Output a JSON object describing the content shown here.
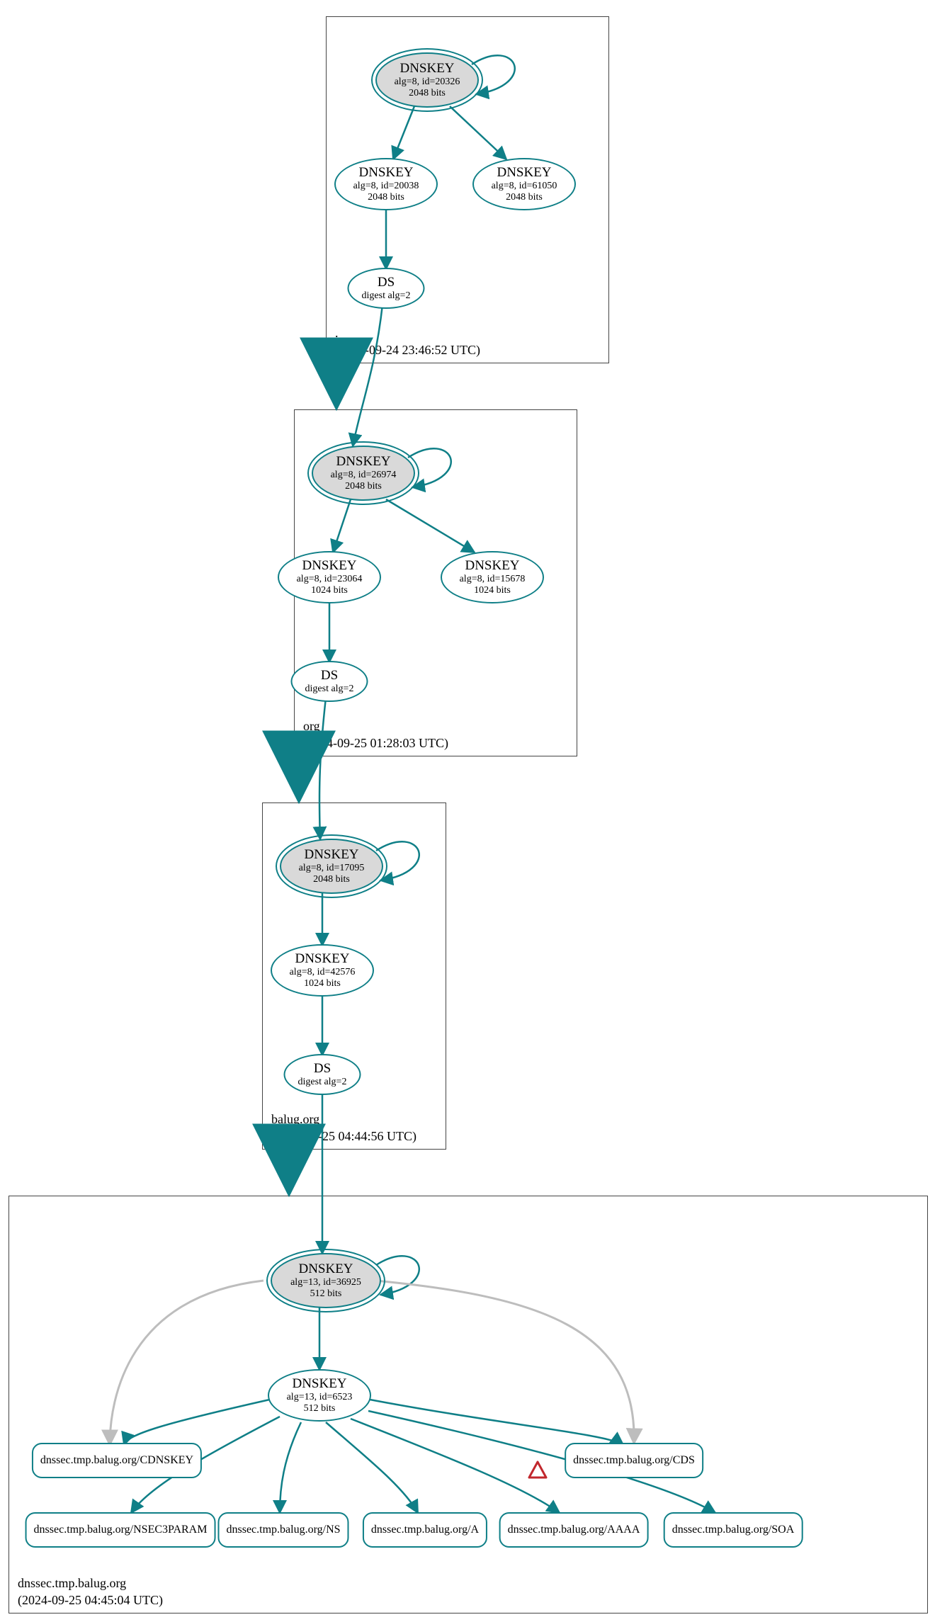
{
  "colors": {
    "edge": "#0F7F87",
    "gray": "#bdbdbd",
    "warn": "#C1272D"
  },
  "zones": {
    "root": {
      "label": ".",
      "timestamp": "(2024-09-24 23:46:52 UTC)"
    },
    "org": {
      "label": "org",
      "timestamp": "(2024-09-25 01:28:03 UTC)"
    },
    "balug": {
      "label": "balug.org",
      "timestamp": "(2024-09-25 04:44:56 UTC)"
    },
    "dnssec": {
      "label": "dnssec.tmp.balug.org",
      "timestamp": "(2024-09-25 04:45:04 UTC)"
    }
  },
  "nodes": {
    "root_ksk": {
      "title": "DNSKEY",
      "line2": "alg=8, id=20326",
      "line3": "2048 bits"
    },
    "root_zsk1": {
      "title": "DNSKEY",
      "line2": "alg=8, id=20038",
      "line3": "2048 bits"
    },
    "root_zsk2": {
      "title": "DNSKEY",
      "line2": "alg=8, id=61050",
      "line3": "2048 bits"
    },
    "root_ds": {
      "title": "DS",
      "line2": "digest alg=2"
    },
    "org_ksk": {
      "title": "DNSKEY",
      "line2": "alg=8, id=26974",
      "line3": "2048 bits"
    },
    "org_zsk1": {
      "title": "DNSKEY",
      "line2": "alg=8, id=23064",
      "line3": "1024 bits"
    },
    "org_zsk2": {
      "title": "DNSKEY",
      "line2": "alg=8, id=15678",
      "line3": "1024 bits"
    },
    "org_ds": {
      "title": "DS",
      "line2": "digest alg=2"
    },
    "balug_ksk": {
      "title": "DNSKEY",
      "line2": "alg=8, id=17095",
      "line3": "2048 bits"
    },
    "balug_zsk": {
      "title": "DNSKEY",
      "line2": "alg=8, id=42576",
      "line3": "1024 bits"
    },
    "balug_ds": {
      "title": "DS",
      "line2": "digest alg=2"
    },
    "dnssec_ksk": {
      "title": "DNSKEY",
      "line2": "alg=13, id=36925",
      "line3": "512 bits"
    },
    "dnssec_zsk": {
      "title": "DNSKEY",
      "line2": "alg=13, id=6523",
      "line3": "512 bits"
    }
  },
  "records": {
    "cds": {
      "label": "dnssec.tmp.balug.org/CDS"
    },
    "cdnskey": {
      "label": "dnssec.tmp.balug.org/CDNSKEY"
    },
    "nsec3param": {
      "label": "dnssec.tmp.balug.org/NSEC3PARAM"
    },
    "ns": {
      "label": "dnssec.tmp.balug.org/NS"
    },
    "a": {
      "label": "dnssec.tmp.balug.org/A"
    },
    "aaaa": {
      "label": "dnssec.tmp.balug.org/AAAA"
    },
    "soa": {
      "label": "dnssec.tmp.balug.org/SOA"
    }
  }
}
